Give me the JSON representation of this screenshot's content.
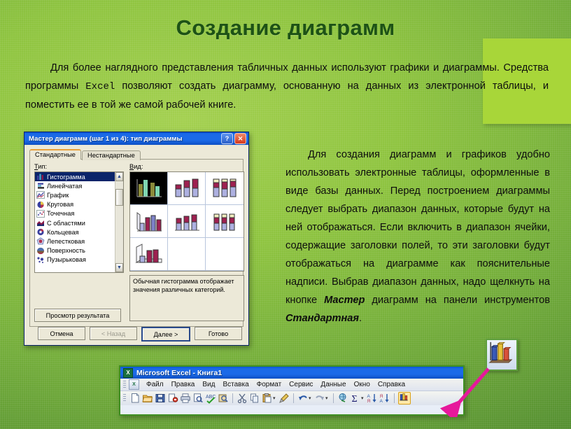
{
  "slide": {
    "title": "Создание  диаграмм",
    "paragraph_top": "Для более наглядного представления табличных данных используют графики и диаграммы. Средства программы ",
    "paragraph_top_mono": "Excel",
    "paragraph_top_2": " позволяют создать диаграмму, основанную на данных из электронной таблицы, и поместить ее в той же самой рабочей книге.",
    "paragraph_right_a": "Для создания диаграмм и графиков удобно использовать электронные таблицы, оформленные в виде базы данных. Перед построением диаграммы следует выбрать диапазон данных, которые будут на ней отображаться. Если включить в диапазон ячейки, содержащие заголовки полей, то эти заголовки будут отображаться на диаграмме как пояснительные надписи. Выбрав диапазон данных, надо щелкнуть на кнопке ",
    "paragraph_right_b": "Мастер",
    "paragraph_right_c": " диаграмм на панели инструментов ",
    "paragraph_right_d": "Стандартная",
    "paragraph_right_e": "."
  },
  "colors": {
    "slide_bg_light": "#a3d04f",
    "slide_bg_dark": "#4f8a2f",
    "title_text": "#1d5216",
    "highlight_box": "#a8d639",
    "dialog_face": "#ece9d8",
    "titlebar_blue": "#1b6ae8",
    "selection_blue": "#0a246a",
    "arrow_magenta": "#e6189b",
    "excel_border_green": "#3f8f22"
  },
  "dialog": {
    "title": "Мастер диаграмм (шаг 1 из 4): тип диаграммы",
    "help_button": "?",
    "close_button": "✕",
    "tabs": [
      {
        "label": "Стандартные",
        "active": true
      },
      {
        "label": "Нестандартные",
        "active": false
      }
    ],
    "type_label": "Тип:",
    "view_label": "Вид:",
    "chart_types": [
      {
        "label": "Гистограмма",
        "selected": true
      },
      {
        "label": "Линейчатая",
        "selected": false
      },
      {
        "label": "График",
        "selected": false
      },
      {
        "label": "Круговая",
        "selected": false
      },
      {
        "label": "Точечная",
        "selected": false
      },
      {
        "label": "С областями",
        "selected": false
      },
      {
        "label": "Кольцевая",
        "selected": false
      },
      {
        "label": "Лепестковая",
        "selected": false
      },
      {
        "label": "Поверхность",
        "selected": false
      },
      {
        "label": "Пузырьковая",
        "selected": false
      }
    ],
    "subtype_count": 7,
    "subtype_selected_index": 0,
    "description": "Обычная гистограмма отображает значения различных категорий.",
    "preview_button": "Просмотр результата",
    "buttons": [
      {
        "label": "Отмена",
        "state": "normal"
      },
      {
        "label": "< Назад",
        "state": "disabled"
      },
      {
        "label": "Далее >",
        "state": "default"
      },
      {
        "label": "Готово",
        "state": "normal"
      }
    ],
    "scroll_up": "▲",
    "scroll_down": "▼"
  },
  "excel": {
    "title": "Microsoft Excel - Книга1",
    "app_icon": "X",
    "menu": [
      "Файл",
      "Правка",
      "Вид",
      "Вставка",
      "Формат",
      "Сервис",
      "Данные",
      "Окно",
      "Справка"
    ],
    "toolbar_icons": [
      "new-document-icon",
      "open-folder-icon",
      "save-icon",
      "email-icon",
      "print-icon",
      "print-preview-icon",
      "search-icon",
      "spellcheck-icon",
      "research-icon",
      "cut-icon",
      "copy-icon",
      "paste-icon",
      "format-painter-icon",
      "undo-icon",
      "redo-icon",
      "hyperlink-icon",
      "autosum-icon",
      "sort-asc-icon",
      "sort-desc-icon",
      "chart-wizard-icon"
    ],
    "chart_wizard_tooltip": "chart-wizard-icon"
  },
  "callout": {
    "magnified_icon": "chart-wizard-icon",
    "arrow": "magenta-arrow"
  }
}
